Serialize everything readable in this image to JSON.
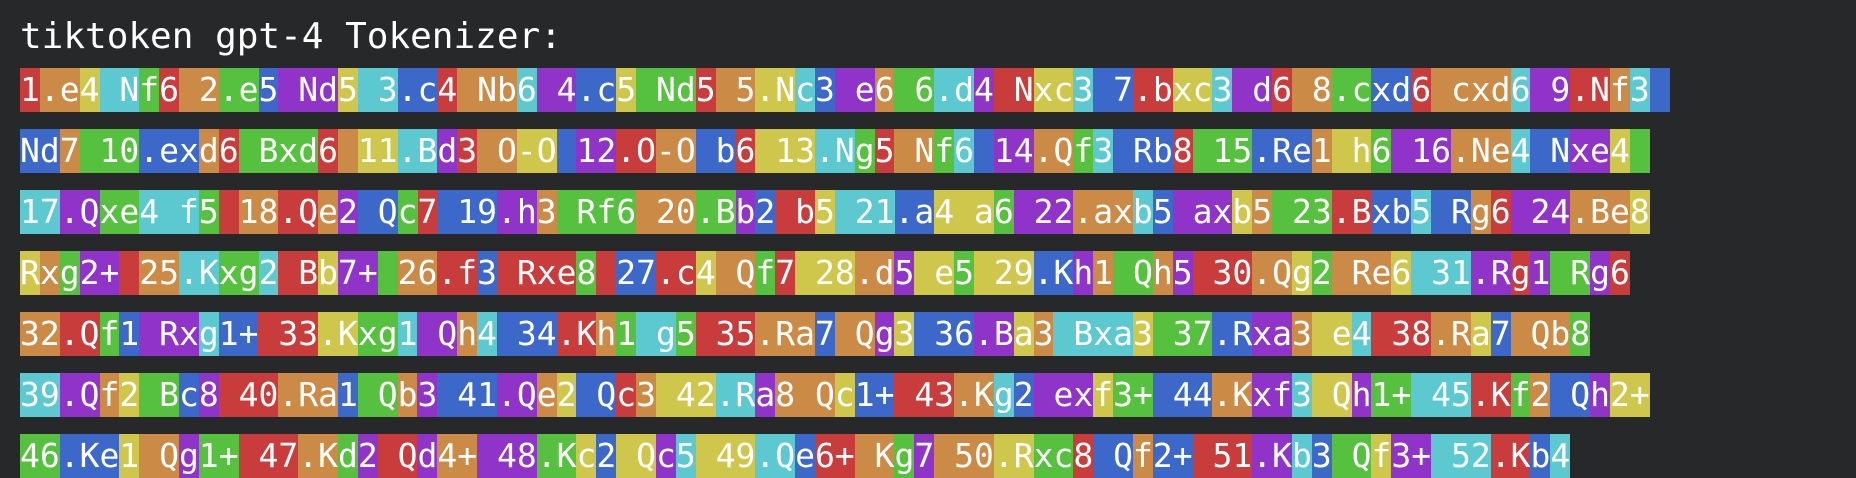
{
  "header": {
    "title": "tiktoken gpt-4 Tokenizer:"
  },
  "palette": {
    "red": "#c83c3c",
    "orange": "#cc8a47",
    "teal": "#5bc9cf",
    "yellow": "#cfc74b",
    "green": "#56c13e",
    "blue": "#3b68c9",
    "purple": "#8f33c9",
    "background": "#272829"
  },
  "lines": [
    [
      [
        "1",
        "red"
      ],
      [
        ".e",
        "orange"
      ],
      [
        "4",
        "yellow"
      ],
      [
        " N",
        "teal"
      ],
      [
        "f",
        "green"
      ],
      [
        "6",
        "red"
      ],
      [
        " ",
        "orange"
      ],
      [
        "2",
        "orange"
      ],
      [
        ".e",
        "green"
      ],
      [
        "5",
        "blue"
      ],
      [
        " Nd",
        "purple"
      ],
      [
        "5",
        "yellow"
      ],
      [
        " ",
        "teal"
      ],
      [
        "3",
        "teal"
      ],
      [
        ".c",
        "blue"
      ],
      [
        "4",
        "red"
      ],
      [
        " Nb",
        "orange"
      ],
      [
        "6",
        "teal"
      ],
      [
        " ",
        "purple"
      ],
      [
        "4",
        "purple"
      ],
      [
        ".c",
        "blue"
      ],
      [
        "5",
        "yellow"
      ],
      [
        " Nd",
        "green"
      ],
      [
        "5",
        "red"
      ],
      [
        " ",
        "orange"
      ],
      [
        "5",
        "orange"
      ],
      [
        ".N",
        "yellow"
      ],
      [
        "c",
        "teal"
      ],
      [
        "3",
        "blue"
      ],
      [
        " e",
        "purple"
      ],
      [
        "6",
        "orange"
      ],
      [
        " ",
        "green"
      ],
      [
        "6",
        "green"
      ],
      [
        ".d",
        "teal"
      ],
      [
        "4",
        "purple"
      ],
      [
        " N",
        "red"
      ],
      [
        "xc",
        "yellow"
      ],
      [
        "3",
        "teal"
      ],
      [
        " ",
        "blue"
      ],
      [
        "7",
        "blue"
      ],
      [
        ".b",
        "red"
      ],
      [
        "xc",
        "yellow"
      ],
      [
        "3",
        "teal"
      ],
      [
        " d",
        "purple"
      ],
      [
        "6",
        "red"
      ],
      [
        " ",
        "orange"
      ],
      [
        "8",
        "orange"
      ],
      [
        ".c",
        "green"
      ],
      [
        "xd",
        "blue"
      ],
      [
        "6",
        "red"
      ],
      [
        " cxd",
        "orange"
      ],
      [
        "6",
        "teal"
      ],
      [
        " ",
        "purple"
      ],
      [
        "9",
        "purple"
      ],
      [
        ".N",
        "red"
      ],
      [
        "f",
        "orange"
      ],
      [
        "3",
        "teal"
      ],
      [
        " ",
        "blue"
      ]
    ],
    [
      [
        "Nd",
        "blue"
      ],
      [
        "7",
        "orange"
      ],
      [
        " ",
        "green"
      ],
      [
        "10",
        "green"
      ],
      [
        ".ex",
        "blue"
      ],
      [
        "d",
        "orange"
      ],
      [
        "6",
        "red"
      ],
      [
        " B",
        "green"
      ],
      [
        "xd",
        "green"
      ],
      [
        "6",
        "red"
      ],
      [
        " ",
        "orange"
      ],
      [
        "11",
        "yellow"
      ],
      [
        ".B",
        "teal"
      ],
      [
        "d",
        "purple"
      ],
      [
        "3",
        "red"
      ],
      [
        " O",
        "orange"
      ],
      [
        "-O",
        "yellow"
      ],
      [
        " ",
        "blue"
      ],
      [
        "12",
        "purple"
      ],
      [
        ".O",
        "red"
      ],
      [
        "-O",
        "orange"
      ],
      [
        " b",
        "blue"
      ],
      [
        "6",
        "red"
      ],
      [
        " ",
        "yellow"
      ],
      [
        "13",
        "yellow"
      ],
      [
        ".N",
        "teal"
      ],
      [
        "g",
        "green"
      ],
      [
        "5",
        "red"
      ],
      [
        " N",
        "orange"
      ],
      [
        "f",
        "green"
      ],
      [
        "6",
        "teal"
      ],
      [
        " ",
        "blue"
      ],
      [
        "14",
        "purple"
      ],
      [
        ".Q",
        "orange"
      ],
      [
        "f",
        "green"
      ],
      [
        "3",
        "teal"
      ],
      [
        " Rb",
        "blue"
      ],
      [
        "8",
        "red"
      ],
      [
        " ",
        "green"
      ],
      [
        "15",
        "green"
      ],
      [
        ".Re",
        "blue"
      ],
      [
        "1",
        "orange"
      ],
      [
        " h",
        "yellow"
      ],
      [
        "6",
        "green"
      ],
      [
        " ",
        "purple"
      ],
      [
        "16",
        "purple"
      ],
      [
        ".Ne",
        "orange"
      ],
      [
        "4",
        "teal"
      ],
      [
        " N",
        "blue"
      ],
      [
        "xe",
        "purple"
      ],
      [
        "4",
        "yellow"
      ],
      [
        " ",
        "green"
      ]
    ],
    [
      [
        "17",
        "teal"
      ],
      [
        ".Q",
        "purple"
      ],
      [
        "xe",
        "green"
      ],
      [
        "4",
        "teal"
      ],
      [
        " f",
        "teal"
      ],
      [
        "5",
        "green"
      ],
      [
        " ",
        "red"
      ],
      [
        "18",
        "orange"
      ],
      [
        ".Q",
        "red"
      ],
      [
        "e",
        "orange"
      ],
      [
        "2",
        "purple"
      ],
      [
        " Q",
        "blue"
      ],
      [
        "c",
        "green"
      ],
      [
        "7",
        "red"
      ],
      [
        " ",
        "blue"
      ],
      [
        "19",
        "blue"
      ],
      [
        ".h",
        "purple"
      ],
      [
        "3",
        "orange"
      ],
      [
        " R",
        "green"
      ],
      [
        "f",
        "green"
      ],
      [
        "6",
        "green"
      ],
      [
        " ",
        "orange"
      ],
      [
        "20",
        "orange"
      ],
      [
        ".B",
        "green"
      ],
      [
        "b",
        "purple"
      ],
      [
        "2",
        "blue"
      ],
      [
        " b",
        "red"
      ],
      [
        "5",
        "yellow"
      ],
      [
        " ",
        "teal"
      ],
      [
        "21",
        "teal"
      ],
      [
        ".a",
        "blue"
      ],
      [
        "4",
        "yellow"
      ],
      [
        " a",
        "yellow"
      ],
      [
        "6",
        "green"
      ],
      [
        " ",
        "purple"
      ],
      [
        "22",
        "purple"
      ],
      [
        ".ax",
        "orange"
      ],
      [
        "b",
        "teal"
      ],
      [
        "5",
        "blue"
      ],
      [
        " ax",
        "purple"
      ],
      [
        "b",
        "yellow"
      ],
      [
        "5",
        "orange"
      ],
      [
        " ",
        "green"
      ],
      [
        "23",
        "green"
      ],
      [
        ".B",
        "red"
      ],
      [
        "xb",
        "blue"
      ],
      [
        "5",
        "teal"
      ],
      [
        " R",
        "blue"
      ],
      [
        "g",
        "orange"
      ],
      [
        "6",
        "red"
      ],
      [
        " ",
        "purple"
      ],
      [
        "24",
        "purple"
      ],
      [
        ".Be",
        "orange"
      ],
      [
        "8",
        "yellow"
      ]
    ],
    [
      [
        "R",
        "yellow"
      ],
      [
        "x",
        "orange"
      ],
      [
        "g",
        "green"
      ],
      [
        "2+",
        "purple"
      ],
      [
        " ",
        "red"
      ],
      [
        "25",
        "orange"
      ],
      [
        ".K",
        "teal"
      ],
      [
        "xg",
        "green"
      ],
      [
        "2",
        "teal"
      ],
      [
        " B",
        "red"
      ],
      [
        "b",
        "yellow"
      ],
      [
        "7+",
        "purple"
      ],
      [
        " ",
        "green"
      ],
      [
        "26",
        "orange"
      ],
      [
        ".f",
        "red"
      ],
      [
        "3",
        "blue"
      ],
      [
        " Rxe",
        "red"
      ],
      [
        "8",
        "green"
      ],
      [
        " ",
        "red"
      ],
      [
        "27",
        "blue"
      ],
      [
        ".c",
        "red"
      ],
      [
        "4",
        "yellow"
      ],
      [
        " Q",
        "orange"
      ],
      [
        "f",
        "green"
      ],
      [
        "7",
        "red"
      ],
      [
        " ",
        "yellow"
      ],
      [
        "28",
        "yellow"
      ],
      [
        ".d",
        "orange"
      ],
      [
        "5",
        "purple"
      ],
      [
        " e",
        "yellow"
      ],
      [
        "5",
        "green"
      ],
      [
        " ",
        "yellow"
      ],
      [
        "29",
        "yellow"
      ],
      [
        ".K",
        "blue"
      ],
      [
        "h",
        "purple"
      ],
      [
        "1",
        "orange"
      ],
      [
        " Q",
        "green"
      ],
      [
        "h",
        "orange"
      ],
      [
        "5",
        "purple"
      ],
      [
        " ",
        "red"
      ],
      [
        "30",
        "red"
      ],
      [
        ".Q",
        "orange"
      ],
      [
        "g",
        "yellow"
      ],
      [
        "2",
        "green"
      ],
      [
        " Re",
        "orange"
      ],
      [
        "6",
        "yellow"
      ],
      [
        " ",
        "teal"
      ],
      [
        "31",
        "teal"
      ],
      [
        ".R",
        "purple"
      ],
      [
        "g",
        "red"
      ],
      [
        "1",
        "purple"
      ],
      [
        " R",
        "green"
      ],
      [
        "g",
        "purple"
      ],
      [
        "6",
        "red"
      ]
    ],
    [
      [
        "32",
        "orange"
      ],
      [
        ".Q",
        "red"
      ],
      [
        "f",
        "green"
      ],
      [
        "1",
        "blue"
      ],
      [
        " Rx",
        "purple"
      ],
      [
        "g",
        "teal"
      ],
      [
        "1+",
        "blue"
      ],
      [
        " ",
        "red"
      ],
      [
        "33",
        "red"
      ],
      [
        ".K",
        "yellow"
      ],
      [
        "xg",
        "green"
      ],
      [
        "1",
        "teal"
      ],
      [
        " Q",
        "purple"
      ],
      [
        "h",
        "orange"
      ],
      [
        "4",
        "teal"
      ],
      [
        " ",
        "blue"
      ],
      [
        "34",
        "blue"
      ],
      [
        ".K",
        "red"
      ],
      [
        "h",
        "orange"
      ],
      [
        "1",
        "green"
      ],
      [
        " g",
        "teal"
      ],
      [
        "5",
        "green"
      ],
      [
        " ",
        "red"
      ],
      [
        "35",
        "red"
      ],
      [
        ".Ra",
        "orange"
      ],
      [
        "7",
        "blue"
      ],
      [
        " Q",
        "orange"
      ],
      [
        "g",
        "purple"
      ],
      [
        "3",
        "yellow"
      ],
      [
        " ",
        "blue"
      ],
      [
        "36",
        "blue"
      ],
      [
        ".B",
        "purple"
      ],
      [
        "a",
        "yellow"
      ],
      [
        "3",
        "orange"
      ],
      [
        " B",
        "teal"
      ],
      [
        "xa",
        "teal"
      ],
      [
        "3",
        "yellow"
      ],
      [
        " ",
        "green"
      ],
      [
        "37",
        "green"
      ],
      [
        ".R",
        "blue"
      ],
      [
        "xa",
        "purple"
      ],
      [
        "3",
        "orange"
      ],
      [
        " e",
        "yellow"
      ],
      [
        "4",
        "teal"
      ],
      [
        " ",
        "red"
      ],
      [
        "38",
        "red"
      ],
      [
        ".R",
        "orange"
      ],
      [
        "a",
        "yellow"
      ],
      [
        "7",
        "blue"
      ],
      [
        " Qb",
        "orange"
      ],
      [
        "8",
        "green"
      ]
    ],
    [
      [
        "39",
        "teal"
      ],
      [
        ".Q",
        "purple"
      ],
      [
        "f",
        "orange"
      ],
      [
        "2",
        "yellow"
      ],
      [
        " B",
        "green"
      ],
      [
        "c",
        "blue"
      ],
      [
        "8",
        "purple"
      ],
      [
        " ",
        "red"
      ],
      [
        "40",
        "red"
      ],
      [
        ".Ra",
        "orange"
      ],
      [
        "1",
        "blue"
      ],
      [
        " Q",
        "green"
      ],
      [
        "b",
        "orange"
      ],
      [
        "3",
        "purple"
      ],
      [
        " ",
        "blue"
      ],
      [
        "41",
        "blue"
      ],
      [
        ".Q",
        "purple"
      ],
      [
        "e",
        "orange"
      ],
      [
        "2",
        "yellow"
      ],
      [
        " Q",
        "blue"
      ],
      [
        "c",
        "red"
      ],
      [
        "3",
        "orange"
      ],
      [
        " ",
        "yellow"
      ],
      [
        "42",
        "yellow"
      ],
      [
        ".R",
        "teal"
      ],
      [
        "a",
        "purple"
      ],
      [
        "8",
        "orange"
      ],
      [
        " Q",
        "orange"
      ],
      [
        "c",
        "yellow"
      ],
      [
        "1+",
        "blue"
      ],
      [
        " ",
        "red"
      ],
      [
        "43",
        "red"
      ],
      [
        ".K",
        "orange"
      ],
      [
        "g",
        "teal"
      ],
      [
        "2",
        "blue"
      ],
      [
        " ex",
        "purple"
      ],
      [
        "f",
        "yellow"
      ],
      [
        "3+",
        "green"
      ],
      [
        " ",
        "blue"
      ],
      [
        "44",
        "blue"
      ],
      [
        ".K",
        "orange"
      ],
      [
        "xf",
        "purple"
      ],
      [
        "3",
        "teal"
      ],
      [
        " Q",
        "yellow"
      ],
      [
        "h",
        "purple"
      ],
      [
        "1+",
        "green"
      ],
      [
        " ",
        "teal"
      ],
      [
        "45",
        "teal"
      ],
      [
        ".K",
        "red"
      ],
      [
        "f",
        "green"
      ],
      [
        "2",
        "orange"
      ],
      [
        " Q",
        "blue"
      ],
      [
        "h",
        "purple"
      ],
      [
        "2+",
        "yellow"
      ]
    ],
    [
      [
        "46",
        "green"
      ],
      [
        ".Ke",
        "blue"
      ],
      [
        "1",
        "yellow"
      ],
      [
        " Q",
        "orange"
      ],
      [
        "g",
        "purple"
      ],
      [
        "1+",
        "green"
      ],
      [
        " ",
        "red"
      ],
      [
        "47",
        "red"
      ],
      [
        ".K",
        "orange"
      ],
      [
        "d",
        "green"
      ],
      [
        "2",
        "purple"
      ],
      [
        " Q",
        "red"
      ],
      [
        "d",
        "purple"
      ],
      [
        "4+",
        "orange"
      ],
      [
        " ",
        "purple"
      ],
      [
        "48",
        "purple"
      ],
      [
        ".K",
        "green"
      ],
      [
        "c",
        "yellow"
      ],
      [
        "2",
        "blue"
      ],
      [
        " Q",
        "yellow"
      ],
      [
        "c",
        "purple"
      ],
      [
        "5",
        "teal"
      ],
      [
        " ",
        "yellow"
      ],
      [
        "49",
        "yellow"
      ],
      [
        ".Q",
        "teal"
      ],
      [
        "e",
        "blue"
      ],
      [
        "6+",
        "red"
      ],
      [
        " K",
        "orange"
      ],
      [
        "g",
        "green"
      ],
      [
        "7",
        "purple"
      ],
      [
        " ",
        "orange"
      ],
      [
        "50",
        "orange"
      ],
      [
        ".R",
        "yellow"
      ],
      [
        "xc",
        "green"
      ],
      [
        "8",
        "red"
      ],
      [
        " Q",
        "blue"
      ],
      [
        "f",
        "orange"
      ],
      [
        "2+",
        "blue"
      ],
      [
        " ",
        "red"
      ],
      [
        "51",
        "red"
      ],
      [
        ".K",
        "purple"
      ],
      [
        "b",
        "teal"
      ],
      [
        "3",
        "blue"
      ],
      [
        " Q",
        "green"
      ],
      [
        "f",
        "yellow"
      ],
      [
        "3+",
        "purple"
      ],
      [
        " ",
        "teal"
      ],
      [
        "52",
        "teal"
      ],
      [
        ".K",
        "red"
      ],
      [
        "b",
        "blue"
      ],
      [
        "4",
        "teal"
      ]
    ]
  ]
}
